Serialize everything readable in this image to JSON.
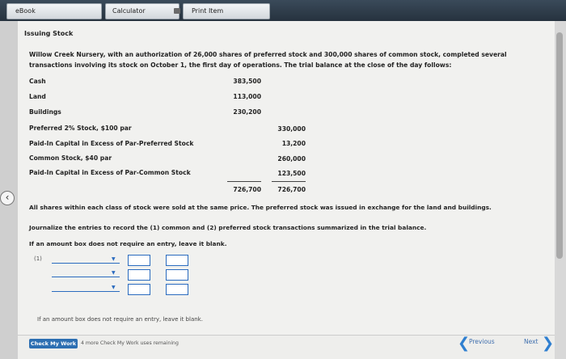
{
  "tabs": {
    "ebook": "eBook",
    "calculator": "Calculator",
    "print": "Print Item"
  },
  "problem": {
    "title": "Issuing Stock",
    "intro": "Willow Creek Nursery, with an authorization of 26,000 shares of preferred stock and 300,000 shares of common stock, completed several transactions involving its stock on October 1, the first day of operations. The trial balance at the close of the day follows:"
  },
  "trial_balance": {
    "rows": [
      {
        "account": "Cash",
        "debit": "383,500",
        "credit": ""
      },
      {
        "account": "Land",
        "debit": "113,000",
        "credit": ""
      },
      {
        "account": "Buildings",
        "debit": "230,200",
        "credit": ""
      },
      {
        "account": "Preferred 2% Stock, $100 par",
        "debit": "",
        "credit": "330,000"
      },
      {
        "account": "Paid-In Capital in Excess of Par-Preferred Stock",
        "debit": "",
        "credit": "13,200"
      },
      {
        "account": "Common Stock, $40 par",
        "debit": "",
        "credit": "260,000"
      },
      {
        "account": "Paid-In Capital in Excess of Par-Common Stock",
        "debit": "",
        "credit": "123,500"
      }
    ],
    "total_debit": "726,700",
    "total_credit": "726,700"
  },
  "text": {
    "shares_note": "All shares within each class of stock were sold at the same price. The preferred stock was issued in exchange for the land and buildings.",
    "instruction": "Journalize the entries to record the (1) common and (2) preferred stock transactions summarized in the trial balance.",
    "blank_note": "If an amount box does not require an entry, leave it blank.",
    "entry_label": "(1)",
    "blank_note_2": "If an amount box does not require an entry, leave it blank."
  },
  "footer": {
    "check_button": "Check My Work",
    "remaining": "4 more Check My Work uses remaining",
    "previous": "Previous",
    "next": "Next"
  }
}
